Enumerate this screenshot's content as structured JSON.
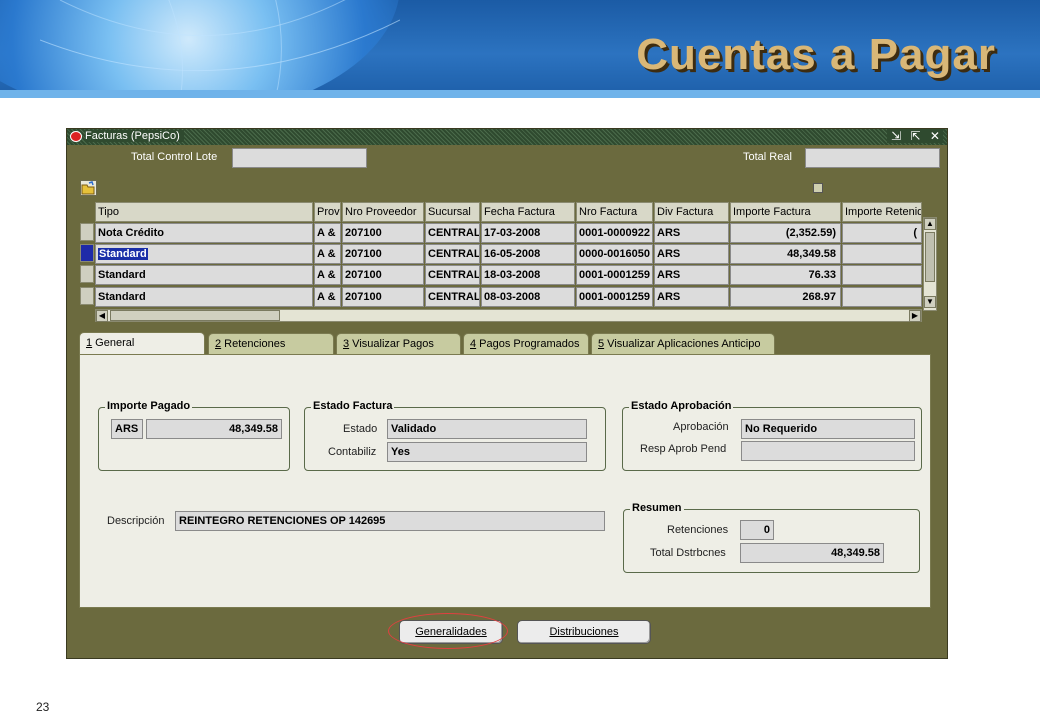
{
  "slide": {
    "title": "Cuentas a Pagar",
    "page_number": "23"
  },
  "window": {
    "title": "Facturas (PepsiCo)",
    "title_buttons": "⇲ ⇱ ✕",
    "total_control_lote_label": "Total Control Lote",
    "total_control_lote_value": "",
    "total_real_label": "Total Real",
    "total_real_value": ""
  },
  "grid": {
    "headers": [
      "Tipo",
      "Prov",
      "Nro Proveedor",
      "Sucursal",
      "Fecha Factura",
      "Nro Factura",
      "Div Factura",
      "Importe Factura",
      "Importe Retenido"
    ],
    "rows": [
      {
        "tipo": "Nota Crédito",
        "prov": "A &",
        "nro_proveedor": "207100",
        "sucursal": "CENTRAL",
        "fecha": "17-03-2008",
        "nro_factura": "0001-0000922",
        "div": "ARS",
        "importe": "(2,352.59)",
        "retenido": "("
      },
      {
        "tipo": "Standard",
        "prov": "A &",
        "nro_proveedor": "207100",
        "sucursal": "CENTRAL",
        "fecha": "16-05-2008",
        "nro_factura": "0000-0016050",
        "div": "ARS",
        "importe": "48,349.58",
        "retenido": ""
      },
      {
        "tipo": "Standard",
        "prov": "A &",
        "nro_proveedor": "207100",
        "sucursal": "CENTRAL",
        "fecha": "18-03-2008",
        "nro_factura": "0001-0001259",
        "div": "ARS",
        "importe": "76.33",
        "retenido": ""
      },
      {
        "tipo": "Standard",
        "prov": "A &",
        "nro_proveedor": "207100",
        "sucursal": "CENTRAL",
        "fecha": "08-03-2008",
        "nro_factura": "0001-0001259",
        "div": "ARS",
        "importe": "268.97",
        "retenido": ""
      }
    ]
  },
  "tabs": [
    {
      "key": "1",
      "label": " General"
    },
    {
      "key": "2",
      "label": " Retenciones"
    },
    {
      "key": "3",
      "label": " Visualizar Pagos"
    },
    {
      "key": "4",
      "label": " Pagos Programados"
    },
    {
      "key": "5",
      "label": " Visualizar Aplicaciones Anticipo"
    }
  ],
  "general": {
    "importe_pagado": {
      "title": "Importe Pagado",
      "currency": "ARS",
      "amount": "48,349.58"
    },
    "estado_factura": {
      "title": "Estado Factura",
      "estado_label": "Estado",
      "estado_value": "Validado",
      "contabiliz_label": "Contabiliz",
      "contabiliz_value": "Yes"
    },
    "estado_aprobacion": {
      "title": "Estado Aprobación",
      "aprobacion_label": "Aprobación",
      "aprobacion_value": "No Requerido",
      "resp_label": "Resp Aprob Pend",
      "resp_value": ""
    },
    "descripcion_label": "Descripción",
    "descripcion_value": "REINTEGRO RETENCIONES OP 142695",
    "resumen": {
      "title": "Resumen",
      "retenciones_label": "Retenciones",
      "retenciones_value": "0",
      "total_label": "Total Dstrbcnes",
      "total_value": "48,349.58"
    }
  },
  "buttons": {
    "generalidades": "Generalidades",
    "distribuciones": "Distribuciones"
  },
  "colors": {
    "window_bg": "#6b6a3e",
    "selection": "#1a2ea8",
    "title_gold": "#d9b777",
    "highlight": "#e04040"
  }
}
